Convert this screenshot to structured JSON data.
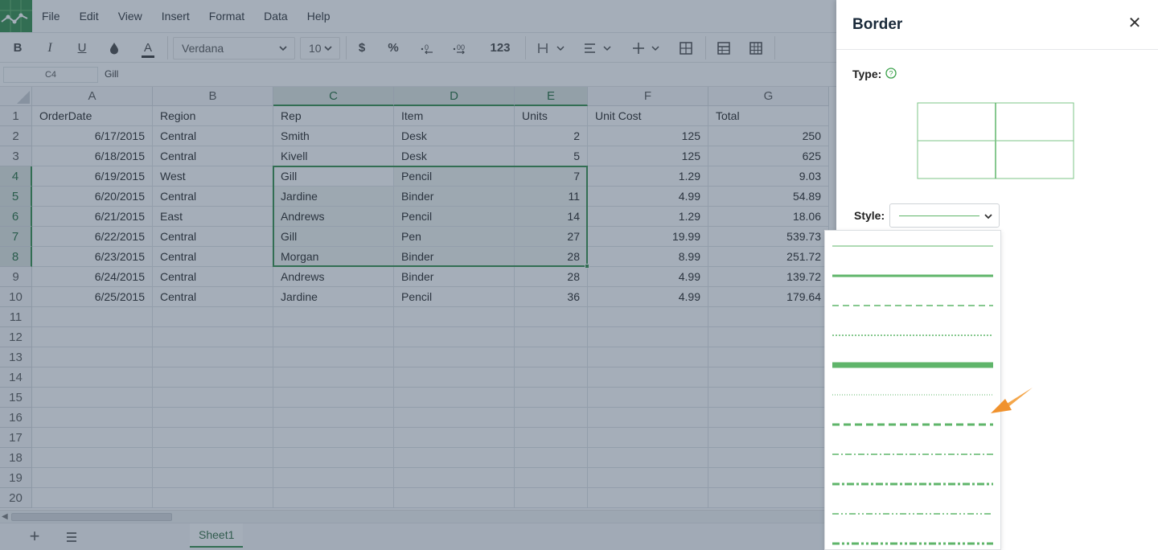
{
  "menu": {
    "file": "File",
    "edit": "Edit",
    "view": "View",
    "insert": "Insert",
    "format": "Format",
    "data": "Data",
    "help": "Help"
  },
  "toolbar": {
    "bold": "B",
    "italic": "I",
    "underline": "U",
    "font_color": "A",
    "font_name": "Verdana",
    "font_size": "10",
    "currency": "$",
    "percent": "%",
    "number_format": "123"
  },
  "formula_bar": {
    "cell_ref": "C4",
    "value": "Gill"
  },
  "sheet": {
    "columns": [
      "A",
      "B",
      "C",
      "D",
      "E",
      "F",
      "G"
    ],
    "rows": [
      "1",
      "2",
      "3",
      "4",
      "5",
      "6",
      "7",
      "8",
      "9",
      "10",
      "11",
      "12",
      "13",
      "14",
      "15",
      "16",
      "17",
      "18",
      "19",
      "20"
    ],
    "cells": [
      [
        "OrderDate",
        "Region",
        "Rep",
        "Item",
        "Units",
        "Unit Cost",
        "Total"
      ],
      [
        "6/17/2015",
        "Central",
        "Smith",
        "Desk",
        "2",
        "125",
        "250"
      ],
      [
        "6/18/2015",
        "Central",
        "Kivell",
        "Desk",
        "5",
        "125",
        "625"
      ],
      [
        "6/19/2015",
        "West",
        "Gill",
        "Pencil",
        "7",
        "1.29",
        "9.03"
      ],
      [
        "6/20/2015",
        "Central",
        "Jardine",
        "Binder",
        "11",
        "4.99",
        "54.89"
      ],
      [
        "6/21/2015",
        "East",
        "Andrews",
        "Pencil",
        "14",
        "1.29",
        "18.06"
      ],
      [
        "6/22/2015",
        "Central",
        "Gill",
        "Pen",
        "27",
        "19.99",
        "539.73"
      ],
      [
        "6/23/2015",
        "Central",
        "Morgan",
        "Binder",
        "28",
        "8.99",
        "251.72"
      ],
      [
        "6/24/2015",
        "Central",
        "Andrews",
        "Binder",
        "28",
        "4.99",
        "139.72"
      ],
      [
        "6/25/2015",
        "Central",
        "Jardine",
        "Pencil",
        "36",
        "4.99",
        "179.64"
      ]
    ]
  },
  "sheet_tabs": {
    "active": "Sheet1"
  },
  "border_panel": {
    "title": "Border",
    "close": "✕",
    "type_label": "Type:",
    "style_label": "Style:",
    "style_options": [
      "thin",
      "medium",
      "dashed",
      "dotted",
      "thick",
      "hair",
      "medium-dashed",
      "dash-dot",
      "medium-dash-dot",
      "dash-dot-dot",
      "medium-dash-dot-dot"
    ]
  },
  "colors": {
    "accent_green": "#2e8a45",
    "border_line_green": "#5fb56a",
    "annotation_arrow": "#f0922e",
    "overlay": "rgba(55,75,100,0.45)"
  }
}
